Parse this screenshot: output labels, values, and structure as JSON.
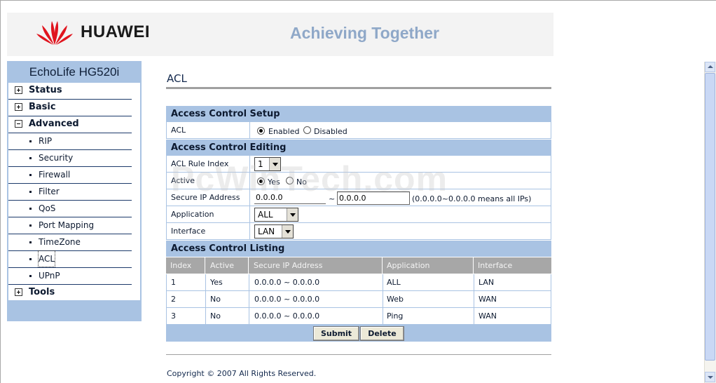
{
  "header": {
    "brand": "HUAWEI",
    "slogan": "Achieving Together"
  },
  "sidebar": {
    "title": "EchoLife HG520i",
    "menu": [
      {
        "label": "Status",
        "expanded": false
      },
      {
        "label": "Basic",
        "expanded": false
      },
      {
        "label": "Advanced",
        "expanded": true
      },
      {
        "label": "Tools",
        "expanded": false
      }
    ],
    "advanced_items": [
      "RIP",
      "Security",
      "Firewall",
      "Filter",
      "QoS",
      "Port Mapping",
      "TimeZone",
      "ACL",
      "UPnP"
    ],
    "selected": "ACL"
  },
  "page": {
    "title": "ACL"
  },
  "setup": {
    "section_title": "Access Control Setup",
    "acl_label": "ACL",
    "enabled_label": "Enabled",
    "disabled_label": "Disabled",
    "selected": "Enabled"
  },
  "editing": {
    "section_title": "Access Control Editing",
    "rule_index_label": "ACL Rule Index",
    "rule_index_value": "1",
    "active_label": "Active",
    "yes_label": "Yes",
    "no_label": "No",
    "active_selected": "Yes",
    "secure_ip_label": "Secure IP Address",
    "ip_start": "0.0.0.0",
    "ip_separator": "~",
    "ip_end": "0.0.0.0",
    "ip_hint": "(0.0.0.0~0.0.0.0 means all IPs)",
    "application_label": "Application",
    "application_value": "ALL",
    "interface_label": "Interface",
    "interface_value": "LAN"
  },
  "listing": {
    "section_title": "Access Control Listing",
    "columns": [
      "Index",
      "Active",
      "Secure IP Address",
      "Application",
      "Interface"
    ],
    "rows": [
      [
        "1",
        "Yes",
        "0.0.0.0 ~ 0.0.0.0",
        "ALL",
        "LAN"
      ],
      [
        "2",
        "No",
        "0.0.0.0 ~ 0.0.0.0",
        "Web",
        "WAN"
      ],
      [
        "3",
        "No",
        "0.0.0.0 ~ 0.0.0.0",
        "Ping",
        "WAN"
      ]
    ]
  },
  "buttons": {
    "submit": "Submit",
    "delete": "Delete"
  },
  "footer": {
    "copyright": "Copyright © 2007 All Rights Reserved."
  },
  "watermark": "PcWinTech.com",
  "colors": {
    "accent_blue": "#a9c3e3",
    "header_gray": "#a7a7a7",
    "logo_red": "#e0141e"
  },
  "icons": [
    "huawei-logo",
    "expand-plus-icon",
    "collapse-minus-icon",
    "dropdown-arrow-icon"
  ]
}
